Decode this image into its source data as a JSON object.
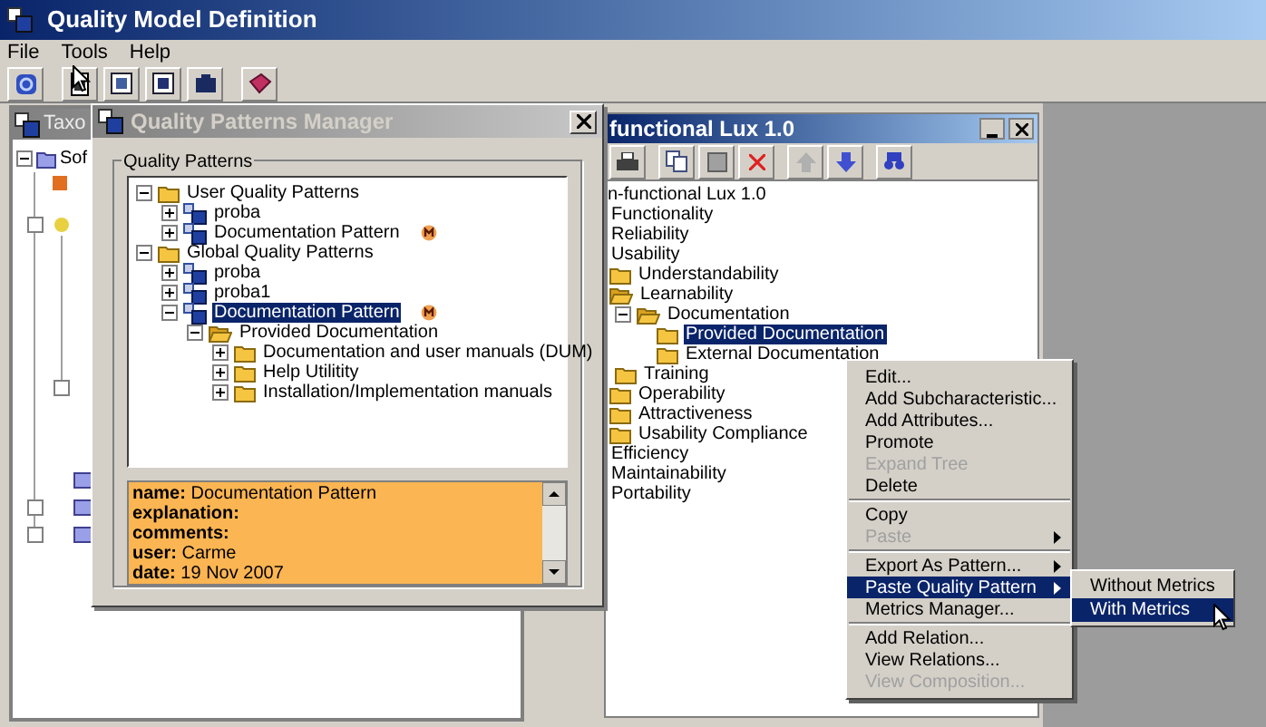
{
  "window": {
    "title": "Quality Model Definition"
  },
  "menu": [
    {
      "label": "File"
    },
    {
      "label": "Tools"
    },
    {
      "label": "Help"
    }
  ],
  "taxonomy_window": {
    "title": "Taxo",
    "tree_root": "Sof"
  },
  "patterns_manager": {
    "title": "Quality Patterns Manager",
    "group_label": "Quality Patterns",
    "tree": [
      {
        "label": "User Quality Patterns",
        "kind": "folder",
        "expanded": true,
        "selected": false,
        "children": [
          {
            "label": "proba",
            "kind": "pattern",
            "expanded": false,
            "selected": false,
            "metrics": false
          },
          {
            "label": "Documentation Pattern",
            "kind": "pattern",
            "expanded": false,
            "selected": false,
            "metrics": true
          }
        ]
      },
      {
        "label": "Global Quality Patterns",
        "kind": "folder",
        "expanded": true,
        "selected": false,
        "children": [
          {
            "label": "proba",
            "kind": "pattern",
            "expanded": false,
            "selected": false,
            "metrics": false
          },
          {
            "label": "proba1",
            "kind": "pattern",
            "expanded": false,
            "selected": false,
            "metrics": false
          },
          {
            "label": "Documentation Pattern",
            "kind": "pattern",
            "expanded": true,
            "selected": true,
            "metrics": true,
            "children": [
              {
                "label": "Provided Documentation",
                "kind": "open_folder",
                "expanded": true,
                "selected": false,
                "children": [
                  {
                    "label": "Documentation and user manuals (DUM)",
                    "kind": "folder",
                    "expanded": false,
                    "selected": false
                  },
                  {
                    "label": "Help Utilitity",
                    "kind": "folder",
                    "expanded": false,
                    "selected": false
                  },
                  {
                    "label": "Installation/Implementation manuals",
                    "kind": "folder",
                    "expanded": false,
                    "selected": false
                  }
                ]
              }
            ]
          }
        ]
      }
    ],
    "details": [
      {
        "label": "name:",
        "value": "Documentation Pattern"
      },
      {
        "label": "explanation:"
      },
      {
        "label": "comments:"
      },
      {
        "label": "user:",
        "value": "Carme"
      },
      {
        "label": "date:",
        "value": "19 Nov 2007"
      }
    ]
  },
  "model_window": {
    "title": "functional Lux 1.0",
    "tree": [
      {
        "label": "n-functional Lux 1.0",
        "selected": false,
        "children": [
          {
            "label": "Functionality",
            "selected": false
          },
          {
            "label": "Reliability",
            "selected": false
          },
          {
            "label": "Usability",
            "selected": false,
            "children": [
              {
                "label": "Understandability",
                "kind": "folder",
                "selected": false
              },
              {
                "label": "Learnability",
                "kind": "open_folder",
                "selected": false,
                "children": [
                  {
                    "label": "Documentation",
                    "kind": "open_folder",
                    "expanded": true,
                    "selected": false,
                    "children": [
                      {
                        "label": "Provided Documentation",
                        "kind": "folder",
                        "selected": true
                      },
                      {
                        "label": "External Documentation",
                        "kind": "folder",
                        "selected": false
                      }
                    ]
                  },
                  {
                    "label": "Training",
                    "kind": "folder",
                    "selected": false
                  }
                ]
              },
              {
                "label": "Operability",
                "kind": "folder",
                "selected": false
              },
              {
                "label": "Attractiveness",
                "kind": "folder",
                "selected": false
              },
              {
                "label": "Usability Compliance",
                "kind": "folder",
                "selected": false
              }
            ]
          },
          {
            "label": "Efficiency",
            "selected": false
          },
          {
            "label": "Maintainability",
            "selected": false
          },
          {
            "label": "Portability",
            "selected": false
          }
        ]
      }
    ]
  },
  "context_menu": {
    "items": [
      {
        "kind": "item",
        "label": "Edit...",
        "disabled": false,
        "submenu": false,
        "selected": false
      },
      {
        "kind": "item",
        "label": "Add Subcharacteristic...",
        "disabled": false,
        "submenu": false,
        "selected": false
      },
      {
        "kind": "item",
        "label": "Add Attributes...",
        "disabled": false,
        "submenu": false,
        "selected": false
      },
      {
        "kind": "item",
        "label": "Promote",
        "disabled": false,
        "submenu": false,
        "selected": false
      },
      {
        "kind": "item",
        "label": "Expand Tree",
        "disabled": true,
        "submenu": false,
        "selected": false
      },
      {
        "kind": "item",
        "label": "Delete",
        "disabled": false,
        "submenu": false,
        "selected": false
      },
      {
        "kind": "separator"
      },
      {
        "kind": "item",
        "label": "Copy",
        "disabled": false,
        "submenu": false,
        "selected": false
      },
      {
        "kind": "item",
        "label": "Paste",
        "disabled": true,
        "submenu": true,
        "selected": false
      },
      {
        "kind": "separator"
      },
      {
        "kind": "item",
        "label": "Export As Pattern...",
        "disabled": false,
        "submenu": true,
        "selected": false
      },
      {
        "kind": "item",
        "label": "Paste Quality Pattern",
        "disabled": false,
        "submenu": true,
        "selected": true
      },
      {
        "kind": "item",
        "label": "Metrics Manager...",
        "disabled": false,
        "submenu": false,
        "selected": false
      },
      {
        "kind": "separator"
      },
      {
        "kind": "item",
        "label": "Add Relation...",
        "disabled": false,
        "submenu": false,
        "selected": false
      },
      {
        "kind": "item",
        "label": "View Relations...",
        "disabled": false,
        "submenu": false,
        "selected": false
      },
      {
        "kind": "item",
        "label": "View Composition...",
        "disabled": true,
        "submenu": false,
        "selected": false
      }
    ]
  },
  "submenu": {
    "items": [
      {
        "label": "Without Metrics",
        "selected": false
      },
      {
        "label": "With Metrics",
        "selected": true
      }
    ]
  }
}
